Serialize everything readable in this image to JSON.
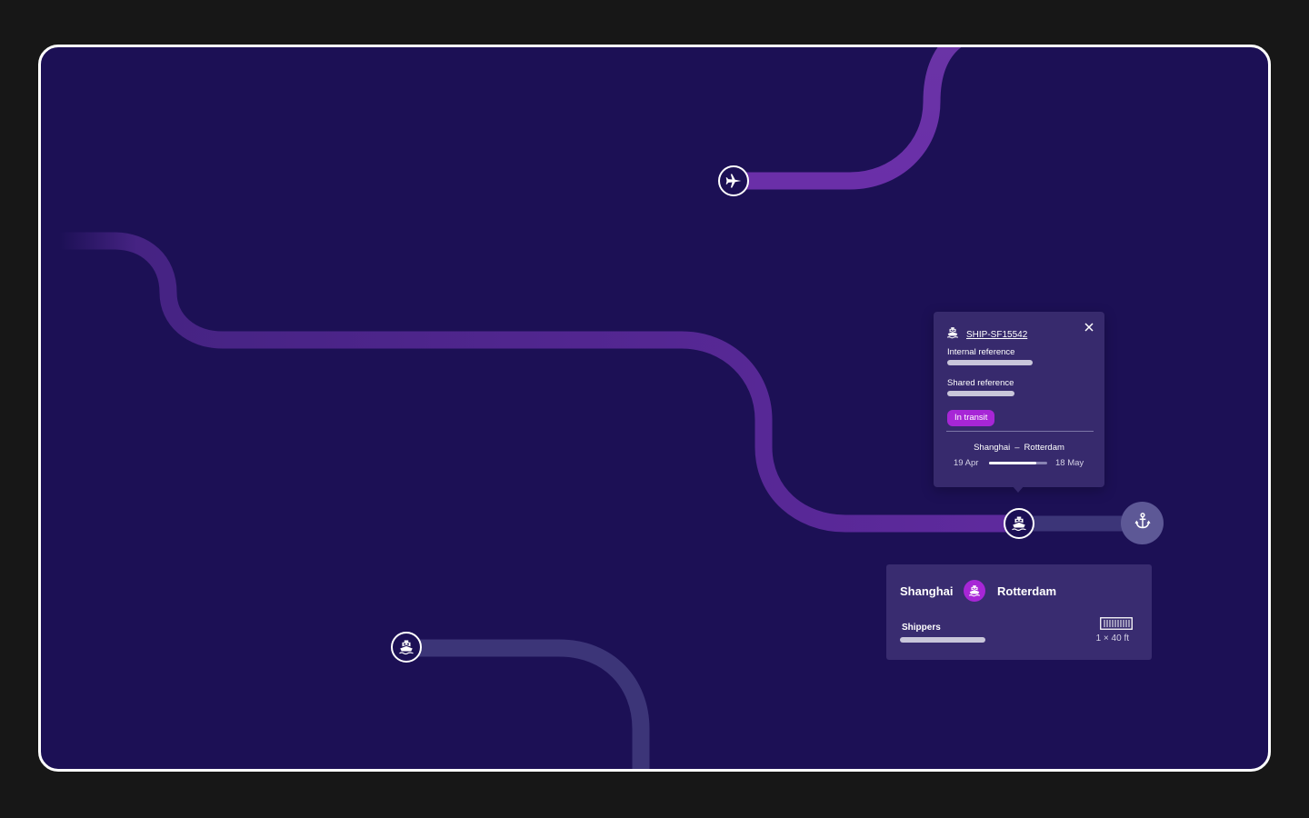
{
  "colors": {
    "page_background": "#171717",
    "canvas_background": "#1c1055",
    "route_active": "#5f2a9e",
    "route_inactive": "#3c3578",
    "accent_purple": "#a726d6",
    "tooltip_background": "#372a6d",
    "card_background": "#392c70",
    "anchor_background": "#5d5896"
  },
  "markers": [
    {
      "name": "plane-marker",
      "icon": "plane-icon"
    },
    {
      "name": "ship-marker-selected",
      "icon": "ship-icon"
    },
    {
      "name": "anchor-marker",
      "icon": "anchor-icon"
    },
    {
      "name": "ship-marker",
      "icon": "ship-icon"
    }
  ],
  "tooltip": {
    "ship_icon": "ship-icon",
    "shipment_id": "SHIP-SF15542",
    "close_icon": "close-icon",
    "internal_reference_label": "Internal reference",
    "shared_reference_label": "Shared reference",
    "status": "In transit",
    "origin": "Shanghai",
    "separator": "–",
    "destination": "Rotterdam",
    "departure_date": "19 Apr",
    "arrival_date": "18 May",
    "progress": 0.82
  },
  "card": {
    "origin": "Shanghai",
    "mode_icon": "ship-icon",
    "destination": "Rotterdam",
    "shippers_label": "Shippers",
    "container_icon": "container-icon",
    "container_count": "1 × 40 ft"
  }
}
